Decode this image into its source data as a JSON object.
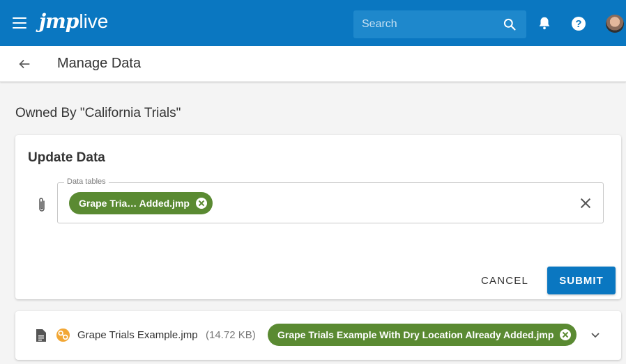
{
  "header": {
    "logo_jmp": "jmp",
    "logo_live": "live",
    "search_placeholder": "Search",
    "help_glyph": "?",
    "brand_color": "#0a77c1",
    "icons": [
      "menu-icon",
      "search-icon",
      "bell-icon",
      "help-icon",
      "avatar"
    ]
  },
  "subheader": {
    "title": "Manage Data",
    "back_icon": "arrow-left-icon"
  },
  "owner_heading": "Owned By \"California Trials\"",
  "update_card": {
    "title": "Update Data",
    "field_label": "Data tables",
    "selected_chip": "Grape Tria… Added.jmp",
    "chip_color": "#5a8a32",
    "cancel_label": "CANCEL",
    "submit_label": "SUBMIT",
    "icons": [
      "paperclip-icon",
      "clear-icon",
      "chip-remove-icon"
    ]
  },
  "file_row": {
    "file_name": "Grape Trials Example.jmp",
    "file_size": "(14.72 KB)",
    "chip_label": "Grape Trials Example With Dry Location Already Added.jmp",
    "icons": [
      "document-icon",
      "shared-icon",
      "chevron-down-icon"
    ]
  }
}
